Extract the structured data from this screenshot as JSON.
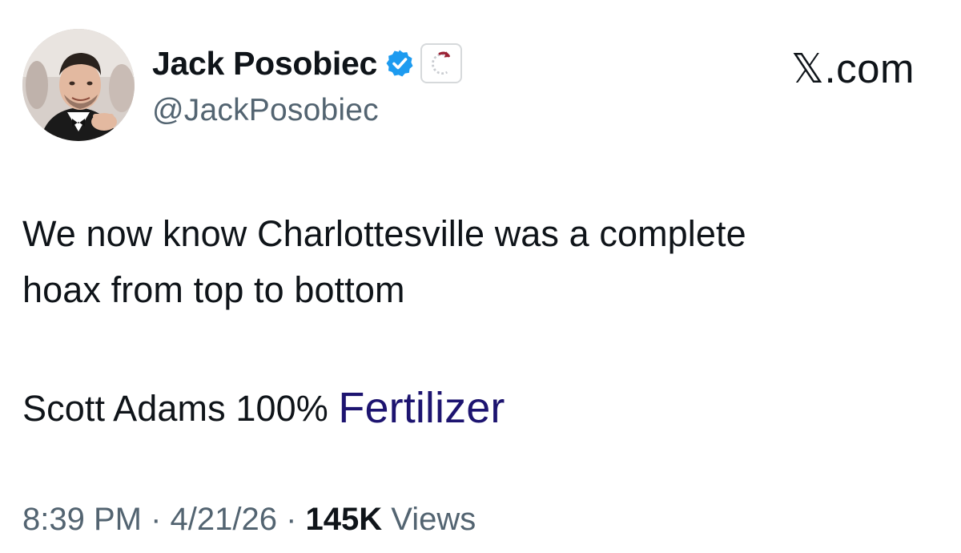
{
  "site": {
    "label": "𝕏.com"
  },
  "author": {
    "display_name": "Jack Posobiec",
    "handle": "@JackPosobiec",
    "verified_icon": "verified-badge-icon",
    "affiliation_icon": "affiliation-badge-icon"
  },
  "tweet": {
    "line1": "We now know Charlottesville was a complete",
    "line2": "hoax from top to bottom",
    "line3_prefix": "Scott Adams 100% ",
    "line3_link": "Fertilizer"
  },
  "meta": {
    "time": "8:39 PM",
    "sep1": " · ",
    "date": "4/21/26",
    "sep2": " · ",
    "views_count": "145K",
    "views_label": " Views"
  },
  "colors": {
    "text": "#0f1419",
    "secondary": "#536471",
    "verified_blue": "#1d9bf0",
    "link": "#1d1470",
    "affiliation_red": "#9b2335"
  }
}
